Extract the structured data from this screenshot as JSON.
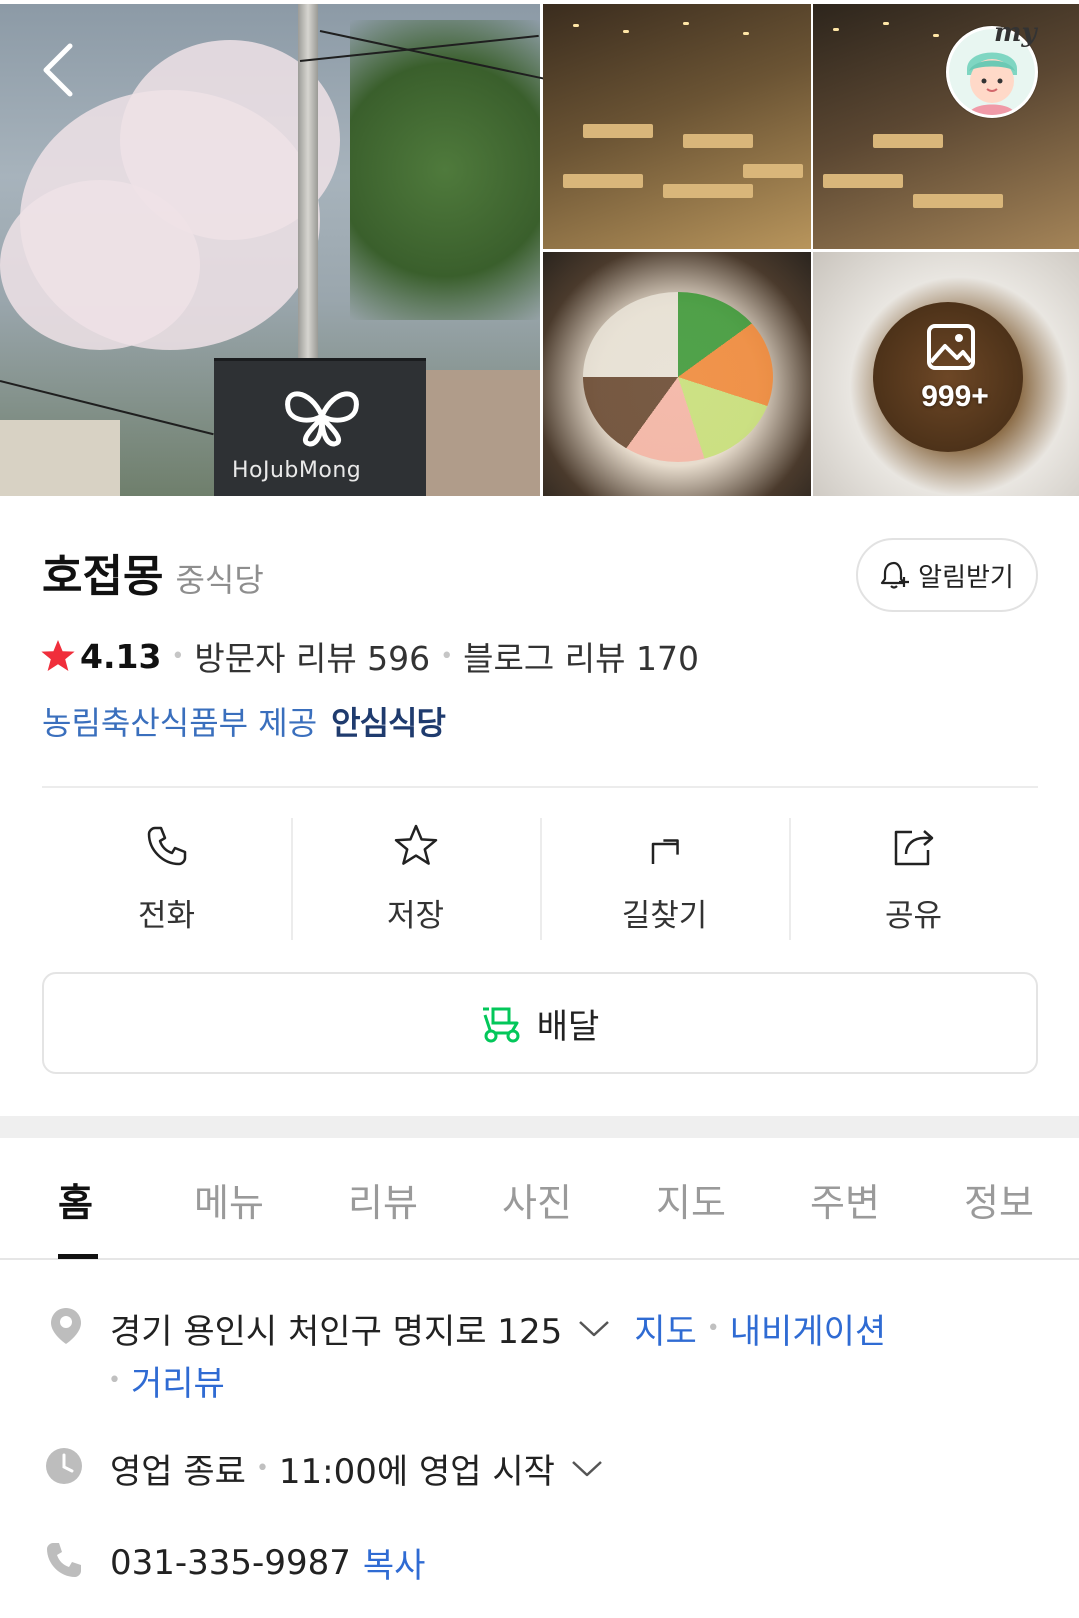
{
  "gallery": {
    "sign_text": "HoJubMong",
    "photo_count": "999+",
    "avatar_badge": "my"
  },
  "place": {
    "name": "호접몽",
    "category": "중식당",
    "notify_label": "알림받기",
    "rating": "4.13",
    "visitor_reviews": "방문자 리뷰 596",
    "blog_reviews": "블로그 리뷰 170",
    "cert_provider": "농림축산식품부 제공",
    "cert_badge": "안심식당"
  },
  "actions": [
    {
      "label": "전화",
      "icon": "phone-icon"
    },
    {
      "label": "저장",
      "icon": "star-outline-icon"
    },
    {
      "label": "길찾기",
      "icon": "directions-icon"
    },
    {
      "label": "공유",
      "icon": "share-icon"
    }
  ],
  "delivery": {
    "label": "배달",
    "icon": "delivery-scooter-icon",
    "color": "#03c75a"
  },
  "tabs": [
    "홈",
    "메뉴",
    "리뷰",
    "사진",
    "지도",
    "주변",
    "정보"
  ],
  "active_tab": "홈",
  "info": {
    "address": "경기 용인시 처인구 명지로 125",
    "map_link": "지도",
    "navigation_link": "내비게이션",
    "streetview_link": "거리뷰",
    "hours_status": "영업 종료",
    "hours_detail": "11:00에 영업 시작",
    "phone": "031-335-9987",
    "copy_link": "복사"
  },
  "colors": {
    "link": "#2f6bd3",
    "star": "#f02e3b",
    "green": "#03c75a"
  }
}
